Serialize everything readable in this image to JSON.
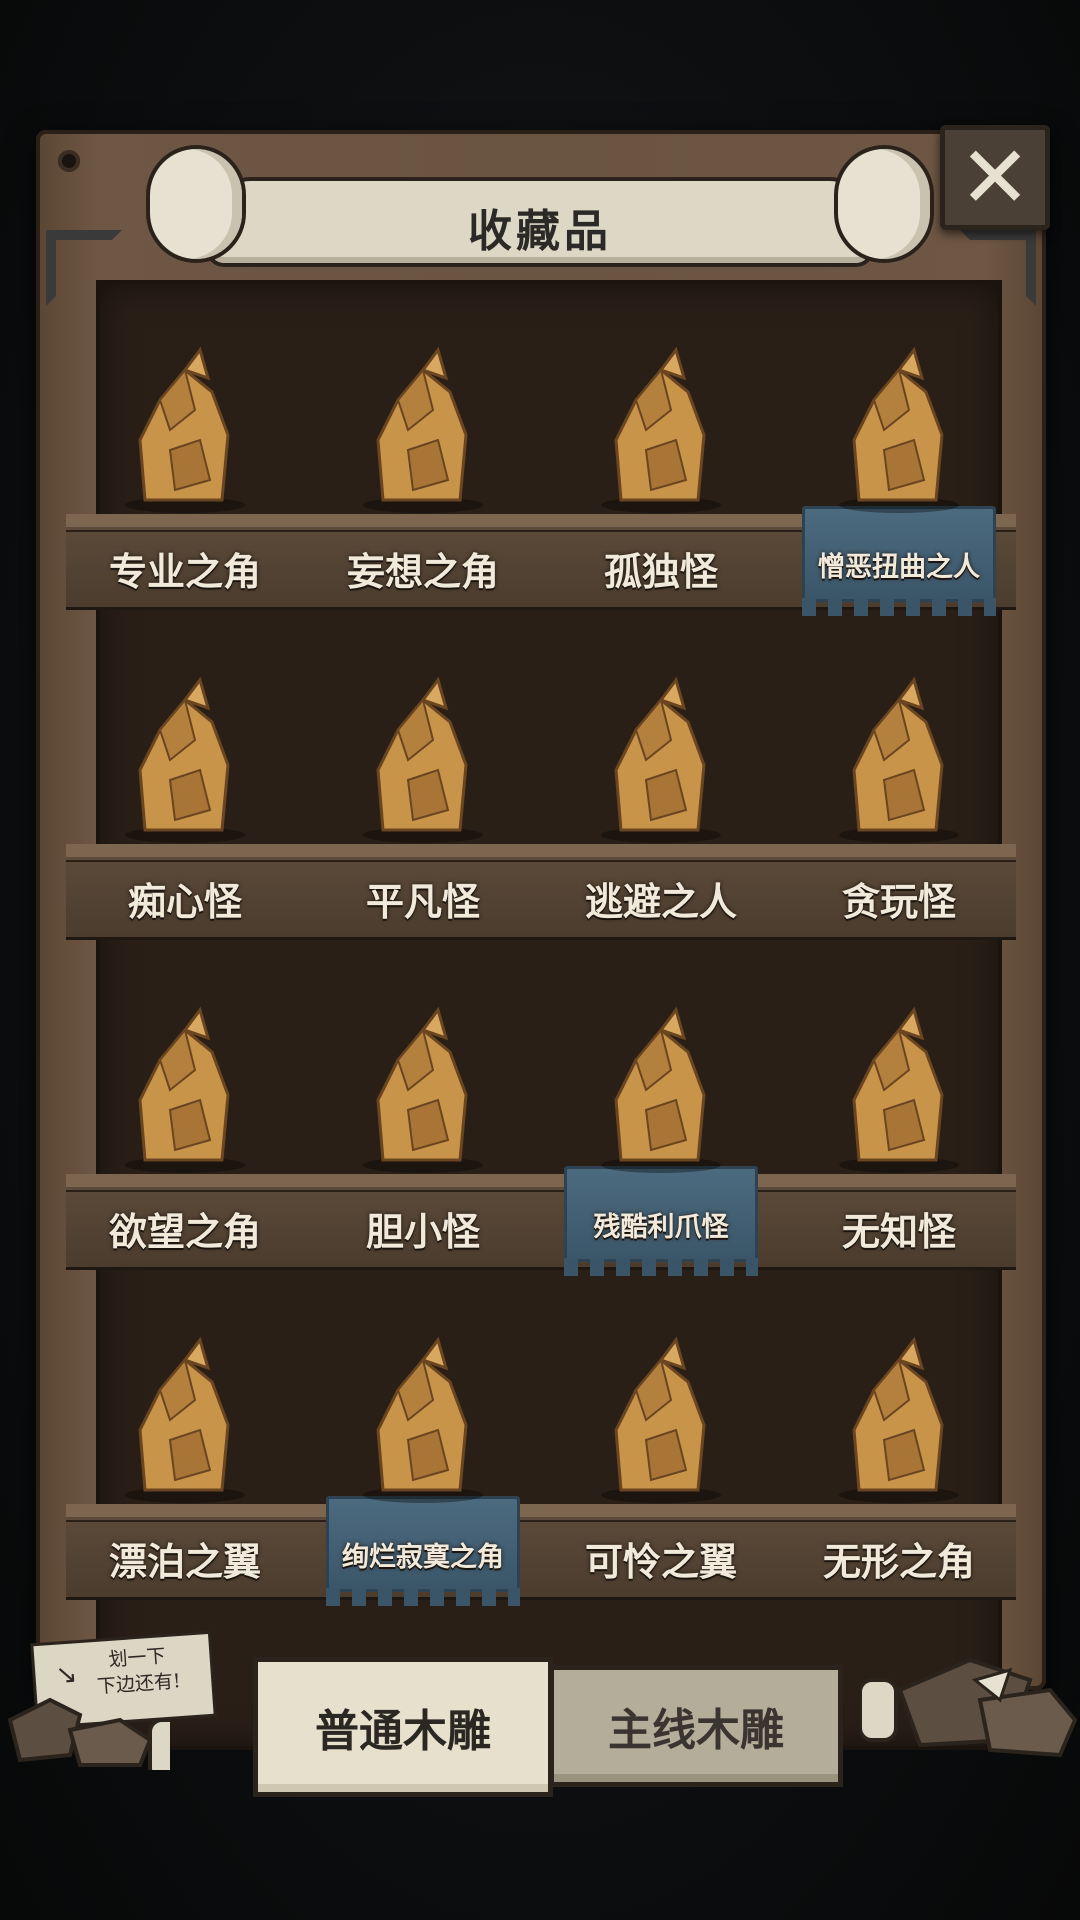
{
  "header": {
    "title": "收藏品",
    "close_icon": "close-x-icon"
  },
  "shelves": [
    {
      "items": [
        {
          "name": "专业之角",
          "icon": "rhino-statue",
          "special": false
        },
        {
          "name": "妄想之角",
          "icon": "cat-statue",
          "special": false
        },
        {
          "name": "孤独怪",
          "icon": "frog-statue",
          "special": false
        },
        {
          "name": "憎恶扭曲之人",
          "icon": "long-nose-man-statue",
          "special": true
        }
      ]
    },
    {
      "items": [
        {
          "name": "痴心怪",
          "icon": "bird-hooded-statue",
          "special": false
        },
        {
          "name": "平凡怪",
          "icon": "horned-beast-statue",
          "special": false
        },
        {
          "name": "逃避之人",
          "icon": "robed-man-statue",
          "special": false
        },
        {
          "name": "贪玩怪",
          "icon": "spider-creature-statue",
          "special": false
        }
      ]
    },
    {
      "items": [
        {
          "name": "欲望之角",
          "icon": "lion-statue",
          "special": false
        },
        {
          "name": "胆小怪",
          "icon": "crouching-creature-statue",
          "special": false
        },
        {
          "name": "残酷利爪怪",
          "icon": "clawed-creature-statue",
          "special": true
        },
        {
          "name": "无知怪",
          "icon": "fish-creature-statue",
          "special": false
        }
      ]
    },
    {
      "items": [
        {
          "name": "漂泊之翼",
          "icon": "pelican-statue",
          "special": false
        },
        {
          "name": "绚烂寂寞之角",
          "icon": "triceratops-gem-statue",
          "special": true
        },
        {
          "name": "可怜之翼",
          "icon": "ibis-statue",
          "special": false
        },
        {
          "name": "无形之角",
          "icon": "elephant-statue",
          "special": false
        }
      ]
    }
  ],
  "hint": {
    "line1": "划一下",
    "line2": "下边还有!"
  },
  "tabs": {
    "normal": "普通木雕",
    "main": "主线木雕"
  },
  "colors": {
    "wood": "#6a5442",
    "shelf_back": "#2a1f17",
    "statue": "#c8944a",
    "special_plate": "#4d6b80",
    "label": "#f1eadb"
  }
}
